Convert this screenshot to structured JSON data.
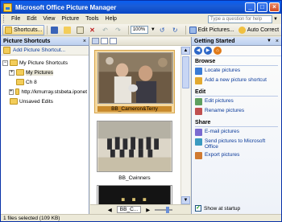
{
  "window": {
    "title": "Microsoft Office Picture Manager"
  },
  "menu": {
    "items": [
      "File",
      "Edit",
      "View",
      "Picture",
      "Tools",
      "Help"
    ],
    "help_placeholder": "Type a question for help"
  },
  "toolbar": {
    "shortcuts_label": "Shortcuts...",
    "zoom_value": "100%",
    "edit_pictures_label": "Edit Pictures...",
    "auto_correct_label": "Auto Correct"
  },
  "left_pane": {
    "title": "Picture Shortcuts",
    "add_shortcut": "Add Picture Shortcut...",
    "tree": [
      {
        "label": "My Picture Shortcuts",
        "expander": "−",
        "level": 0,
        "selected": false
      },
      {
        "label": "My Pictures",
        "expander": "+",
        "level": 1,
        "selected": true
      },
      {
        "label": "Ch 8",
        "expander": "",
        "level": 1,
        "selected": false
      },
      {
        "label": "http://kmurray.stsbeta.iponet",
        "expander": "+",
        "level": 1,
        "selected": false
      },
      {
        "label": "Unsaved Edits",
        "expander": "",
        "level": 0,
        "selected": false
      }
    ]
  },
  "center": {
    "thumbnails": [
      {
        "caption": "BB_Cameron&Terry",
        "selected": true
      },
      {
        "caption": "BB_Cwinners",
        "selected": false
      },
      {
        "caption": "",
        "selected": false
      }
    ],
    "nav_file": "BB_C..."
  },
  "task_pane": {
    "title": "Getting Started",
    "sections": [
      {
        "title": "Browse",
        "tasks": [
          "Locate pictures",
          "Add a new picture shortcut"
        ]
      },
      {
        "title": "Edit",
        "tasks": [
          "Edit pictures",
          "Rename pictures"
        ]
      },
      {
        "title": "Share",
        "tasks": [
          "E-mail pictures",
          "Send pictures to Microsoft Office",
          "Export pictures"
        ]
      }
    ],
    "show_at_startup": "Show at startup"
  },
  "status": {
    "text": "1 files selected (109 KB)"
  },
  "colors": {
    "title_bar": "#0a5ef0",
    "selection": "#f5d9a0",
    "link": "#0a3a9a"
  }
}
